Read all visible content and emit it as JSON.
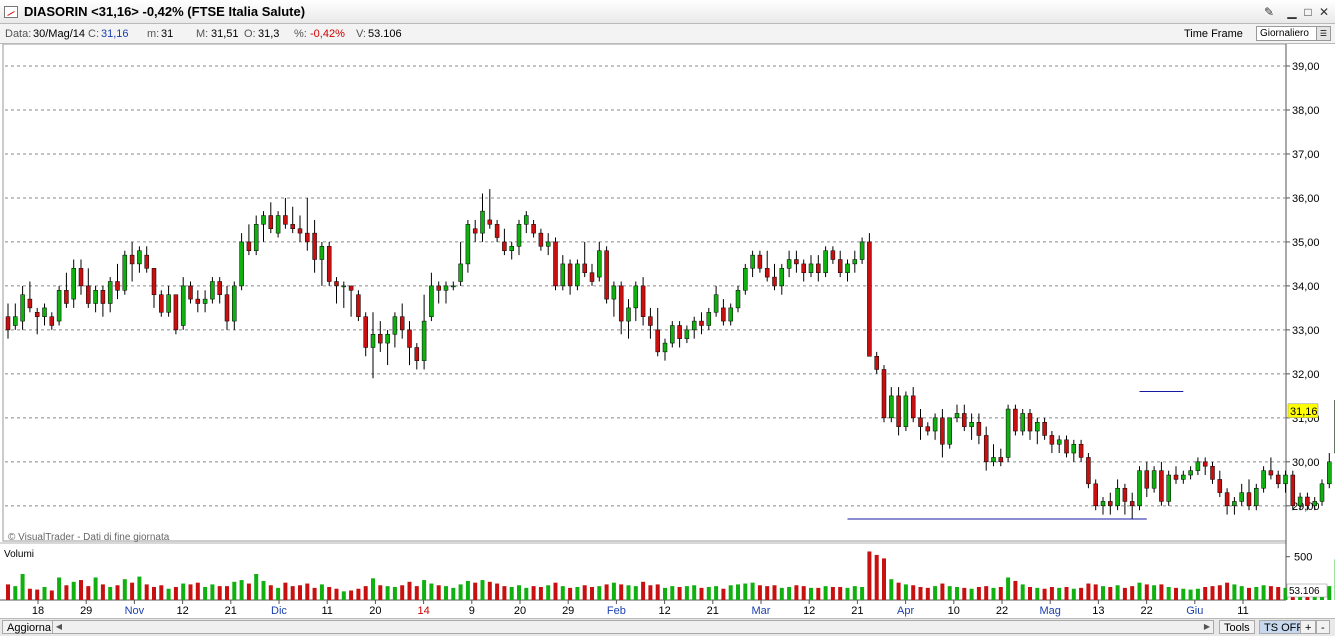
{
  "window": {
    "title": "DIASORIN <31,16> -0,42%  (FTSE Italia Salute)",
    "buttons": [
      "pin",
      "minimize",
      "maximize",
      "close"
    ]
  },
  "infobar": {
    "date_label": "Data:",
    "date_value": "30/Mag/14",
    "close_label": "C:",
    "close_value": "31,16",
    "min_label": "m:",
    "min_value": "31",
    "max_label": "M:",
    "max_value": "31,51",
    "open_label": "O:",
    "open_value": "31,3",
    "pct_label": "%:",
    "pct_value": "-0,42%",
    "vol_label": "V:",
    "vol_value": "53.106",
    "timeframe_label": "Time Frame",
    "timeframe_value": "Giornaliero"
  },
  "footer": {
    "refresh_button": "Aggiorna",
    "tools_button": "Tools",
    "ts_button": "TS OFF",
    "plus": "+",
    "minus": "-"
  },
  "colors": {
    "up": "#10b010",
    "down": "#c81010",
    "line": "#1818a0",
    "last_price_bg": "#ffff00"
  },
  "chart_data": {
    "type": "candlestick",
    "price_axis": {
      "ticks": [
        "29,00",
        "30,00",
        "31,00",
        "32,00",
        "33,00",
        "34,00",
        "35,00",
        "36,00",
        "37,00",
        "38,00",
        "39,00"
      ],
      "range": [
        28.2,
        39.5
      ],
      "grid": true
    },
    "last_price_label": "31,16",
    "watermark": "© VisualTrader - Dati di fine giornata",
    "volume_panel": {
      "label": "Volumi",
      "tick": "500",
      "last_value": "53.106",
      "max": 600
    },
    "x_ticks": [
      {
        "label": "18",
        "color": "#000"
      },
      {
        "label": "29",
        "color": "#000"
      },
      {
        "label": "Nov",
        "color": "#1a3fb0"
      },
      {
        "label": "12",
        "color": "#000"
      },
      {
        "label": "21",
        "color": "#000"
      },
      {
        "label": "Dic",
        "color": "#1a3fb0"
      },
      {
        "label": "11",
        "color": "#000"
      },
      {
        "label": "20",
        "color": "#000"
      },
      {
        "label": "14",
        "color": "#d00000"
      },
      {
        "label": "9",
        "color": "#000"
      },
      {
        "label": "20",
        "color": "#000"
      },
      {
        "label": "29",
        "color": "#000"
      },
      {
        "label": "Feb",
        "color": "#1a3fb0"
      },
      {
        "label": "12",
        "color": "#000"
      },
      {
        "label": "21",
        "color": "#000"
      },
      {
        "label": "Mar",
        "color": "#1a3fb0"
      },
      {
        "label": "12",
        "color": "#000"
      },
      {
        "label": "21",
        "color": "#000"
      },
      {
        "label": "Apr",
        "color": "#1a3fb0"
      },
      {
        "label": "10",
        "color": "#000"
      },
      {
        "label": "22",
        "color": "#000"
      },
      {
        "label": "Mag",
        "color": "#1a3fb0"
      },
      {
        "label": "13",
        "color": "#000"
      },
      {
        "label": "22",
        "color": "#000"
      },
      {
        "label": "Giu",
        "color": "#1a3fb0"
      },
      {
        "label": "11",
        "color": "#000"
      }
    ],
    "support_line": {
      "value": 28.7,
      "from_index": 115,
      "to_index": 156
    },
    "resistance_line": {
      "value": 31.6,
      "from_index": 155,
      "to_index": 161
    },
    "candles": [
      [
        33.3,
        33.6,
        32.8,
        33.0,
        180
      ],
      [
        33.1,
        33.6,
        33.0,
        33.3,
        160
      ],
      [
        33.2,
        34.0,
        33.0,
        33.8,
        300
      ],
      [
        33.7,
        34.1,
        33.4,
        33.5,
        130
      ],
      [
        33.4,
        33.5,
        32.9,
        33.3,
        120
      ],
      [
        33.3,
        33.6,
        33.1,
        33.5,
        150
      ],
      [
        33.3,
        33.4,
        33.0,
        33.1,
        110
      ],
      [
        33.2,
        34.0,
        33.1,
        33.9,
        260
      ],
      [
        33.9,
        34.3,
        33.5,
        33.6,
        170
      ],
      [
        33.7,
        34.6,
        33.5,
        34.4,
        210
      ],
      [
        34.4,
        34.6,
        33.8,
        34.0,
        230
      ],
      [
        34.0,
        34.4,
        33.5,
        33.6,
        160
      ],
      [
        33.6,
        34.0,
        33.4,
        33.9,
        260
      ],
      [
        33.9,
        34.0,
        33.3,
        33.6,
        180
      ],
      [
        33.6,
        34.2,
        33.4,
        34.1,
        150
      ],
      [
        34.1,
        34.5,
        33.7,
        33.9,
        170
      ],
      [
        33.9,
        34.8,
        33.8,
        34.7,
        240
      ],
      [
        34.7,
        35.0,
        34.1,
        34.5,
        200
      ],
      [
        34.5,
        34.9,
        34.3,
        34.8,
        270
      ],
      [
        34.7,
        34.9,
        34.3,
        34.4,
        180
      ],
      [
        34.4,
        34.4,
        33.5,
        33.8,
        150
      ],
      [
        33.8,
        33.9,
        33.3,
        33.4,
        170
      ],
      [
        33.4,
        34.0,
        33.3,
        33.8,
        130
      ],
      [
        33.8,
        33.8,
        32.9,
        33.0,
        150
      ],
      [
        33.1,
        34.2,
        33.0,
        34.0,
        190
      ],
      [
        34.0,
        34.1,
        33.6,
        33.7,
        180
      ],
      [
        33.7,
        33.9,
        33.4,
        33.6,
        200
      ],
      [
        33.6,
        33.9,
        33.4,
        33.7,
        150
      ],
      [
        33.7,
        34.2,
        33.6,
        34.1,
        180
      ],
      [
        34.1,
        34.2,
        33.6,
        33.8,
        160
      ],
      [
        33.8,
        34.0,
        33.0,
        33.2,
        160
      ],
      [
        33.2,
        34.1,
        33.0,
        34.0,
        210
      ],
      [
        34.0,
        35.2,
        33.9,
        35.0,
        230
      ],
      [
        35.0,
        35.4,
        34.7,
        34.8,
        190
      ],
      [
        34.8,
        35.6,
        34.7,
        35.4,
        300
      ],
      [
        35.4,
        35.7,
        35.0,
        35.6,
        220
      ],
      [
        35.6,
        35.9,
        35.2,
        35.3,
        170
      ],
      [
        35.2,
        35.7,
        35.1,
        35.6,
        140
      ],
      [
        35.6,
        36.0,
        35.3,
        35.4,
        200
      ],
      [
        35.4,
        35.8,
        35.2,
        35.3,
        160
      ],
      [
        35.3,
        35.6,
        35.0,
        35.2,
        170
      ],
      [
        35.2,
        36.0,
        34.8,
        35.0,
        190
      ],
      [
        35.2,
        35.5,
        34.3,
        34.6,
        140
      ],
      [
        34.6,
        35.0,
        34.0,
        34.9,
        180
      ],
      [
        34.9,
        35.0,
        34.0,
        34.1,
        150
      ],
      [
        34.1,
        34.2,
        33.6,
        34.0,
        130
      ],
      [
        34.0,
        34.1,
        33.5,
        34.0,
        100
      ],
      [
        34.0,
        34.0,
        33.3,
        33.9,
        110
      ],
      [
        33.8,
        33.9,
        33.2,
        33.3,
        130
      ],
      [
        33.3,
        33.4,
        32.4,
        32.6,
        160
      ],
      [
        32.6,
        33.4,
        31.9,
        32.9,
        250
      ],
      [
        32.9,
        33.2,
        32.5,
        32.7,
        170
      ],
      [
        32.7,
        33.0,
        32.2,
        32.9,
        160
      ],
      [
        32.9,
        33.4,
        32.6,
        33.3,
        150
      ],
      [
        33.3,
        33.6,
        32.8,
        33.0,
        170
      ],
      [
        33.0,
        33.2,
        32.2,
        32.6,
        210
      ],
      [
        32.6,
        32.7,
        32.1,
        32.3,
        160
      ],
      [
        32.3,
        33.8,
        32.1,
        33.2,
        230
      ],
      [
        33.3,
        34.3,
        33.2,
        34.0,
        190
      ],
      [
        34.0,
        34.1,
        33.6,
        33.9,
        170
      ],
      [
        33.9,
        34.1,
        33.6,
        34.0,
        160
      ],
      [
        34.0,
        34.1,
        33.9,
        34.0,
        140
      ],
      [
        34.1,
        35.0,
        34.0,
        34.5,
        180
      ],
      [
        34.5,
        35.5,
        34.3,
        35.4,
        220
      ],
      [
        35.3,
        35.5,
        35.0,
        35.2,
        200
      ],
      [
        35.2,
        36.1,
        35.0,
        35.7,
        230
      ],
      [
        35.5,
        36.2,
        35.3,
        35.4,
        210
      ],
      [
        35.4,
        35.5,
        35.0,
        35.1,
        190
      ],
      [
        35.0,
        35.3,
        34.7,
        34.8,
        160
      ],
      [
        34.8,
        35.0,
        34.6,
        34.9,
        150
      ],
      [
        34.9,
        35.5,
        34.7,
        35.4,
        170
      ],
      [
        35.4,
        35.7,
        35.2,
        35.6,
        140
      ],
      [
        35.4,
        35.5,
        35.1,
        35.2,
        160
      ],
      [
        35.2,
        35.3,
        34.8,
        34.9,
        150
      ],
      [
        34.9,
        35.2,
        34.7,
        35.0,
        170
      ],
      [
        35.0,
        35.1,
        33.9,
        34.0,
        200
      ],
      [
        34.0,
        34.7,
        33.9,
        34.5,
        160
      ],
      [
        34.5,
        34.6,
        33.8,
        34.0,
        140
      ],
      [
        34.0,
        34.6,
        33.9,
        34.5,
        150
      ],
      [
        34.5,
        35.0,
        34.2,
        34.3,
        170
      ],
      [
        34.3,
        34.5,
        34.0,
        34.1,
        150
      ],
      [
        34.2,
        35.0,
        34.1,
        34.8,
        160
      ],
      [
        34.8,
        34.9,
        33.6,
        33.7,
        180
      ],
      [
        33.7,
        34.1,
        33.3,
        34.0,
        200
      ],
      [
        34.0,
        34.1,
        32.9,
        33.2,
        180
      ],
      [
        33.2,
        33.7,
        32.8,
        33.5,
        170
      ],
      [
        33.5,
        34.1,
        33.2,
        34.0,
        160
      ],
      [
        34.0,
        34.2,
        33.1,
        33.3,
        210
      ],
      [
        33.3,
        33.5,
        32.8,
        33.1,
        170
      ],
      [
        33.0,
        33.5,
        32.4,
        32.5,
        180
      ],
      [
        32.5,
        32.8,
        32.3,
        32.7,
        140
      ],
      [
        32.7,
        33.2,
        32.6,
        33.1,
        160
      ],
      [
        33.1,
        33.2,
        32.6,
        32.8,
        150
      ],
      [
        32.8,
        33.1,
        32.7,
        33.0,
        160
      ],
      [
        33.0,
        33.3,
        32.8,
        33.2,
        170
      ],
      [
        33.2,
        33.4,
        32.9,
        33.1,
        140
      ],
      [
        33.1,
        33.5,
        33.0,
        33.4,
        150
      ],
      [
        33.4,
        34.0,
        33.3,
        33.8,
        160
      ],
      [
        33.5,
        33.7,
        33.1,
        33.2,
        130
      ],
      [
        33.2,
        33.6,
        33.1,
        33.5,
        170
      ],
      [
        33.5,
        34.0,
        33.4,
        33.9,
        180
      ],
      [
        33.9,
        34.5,
        33.8,
        34.4,
        190
      ],
      [
        34.4,
        34.8,
        34.2,
        34.7,
        200
      ],
      [
        34.7,
        34.8,
        34.3,
        34.4,
        170
      ],
      [
        34.4,
        34.8,
        34.1,
        34.2,
        160
      ],
      [
        34.2,
        34.5,
        33.9,
        34.0,
        170
      ],
      [
        34.0,
        34.5,
        33.8,
        34.4,
        140
      ],
      [
        34.4,
        34.8,
        34.2,
        34.6,
        150
      ],
      [
        34.6,
        34.8,
        34.3,
        34.5,
        170
      ],
      [
        34.5,
        34.6,
        34.1,
        34.3,
        160
      ],
      [
        34.3,
        34.7,
        34.2,
        34.5,
        140
      ],
      [
        34.5,
        34.7,
        34.1,
        34.3,
        140
      ],
      [
        34.3,
        34.9,
        34.2,
        34.8,
        160
      ],
      [
        34.8,
        34.9,
        34.5,
        34.6,
        150
      ],
      [
        34.6,
        34.8,
        34.2,
        34.3,
        150
      ],
      [
        34.3,
        34.6,
        34.1,
        34.5,
        140
      ],
      [
        34.5,
        34.8,
        34.3,
        34.6,
        160
      ],
      [
        34.6,
        35.1,
        34.5,
        35.0,
        150
      ],
      [
        35.0,
        35.2,
        32.5,
        32.4,
        560
      ],
      [
        32.4,
        32.5,
        32.0,
        32.1,
        520
      ],
      [
        32.1,
        32.2,
        30.9,
        31.0,
        480
      ],
      [
        31.0,
        31.7,
        30.9,
        31.5,
        240
      ],
      [
        31.5,
        31.7,
        30.6,
        30.8,
        200
      ],
      [
        30.8,
        31.6,
        30.7,
        31.5,
        180
      ],
      [
        31.5,
        31.7,
        30.9,
        31.0,
        170
      ],
      [
        31.0,
        31.2,
        30.5,
        30.8,
        150
      ],
      [
        30.8,
        30.9,
        30.6,
        30.7,
        140
      ],
      [
        30.7,
        31.1,
        30.5,
        31.0,
        160
      ],
      [
        31.0,
        31.2,
        30.1,
        30.4,
        190
      ],
      [
        30.4,
        31.0,
        30.3,
        31.0,
        160
      ],
      [
        31.0,
        31.3,
        30.9,
        31.1,
        150
      ],
      [
        31.1,
        31.3,
        30.7,
        30.8,
        140
      ],
      [
        30.8,
        31.1,
        30.5,
        30.9,
        130
      ],
      [
        30.9,
        31.1,
        30.4,
        30.6,
        150
      ],
      [
        30.6,
        30.8,
        29.8,
        30.0,
        160
      ],
      [
        30.0,
        30.4,
        29.9,
        30.1,
        140
      ],
      [
        30.1,
        30.3,
        29.9,
        30.0,
        150
      ],
      [
        30.1,
        31.3,
        30.0,
        31.2,
        260
      ],
      [
        31.2,
        31.3,
        30.6,
        30.7,
        220
      ],
      [
        30.7,
        31.2,
        30.6,
        31.1,
        180
      ],
      [
        31.1,
        31.2,
        30.5,
        30.7,
        150
      ],
      [
        30.7,
        31.0,
        30.4,
        30.9,
        140
      ],
      [
        30.9,
        31.0,
        30.5,
        30.6,
        130
      ],
      [
        30.6,
        30.7,
        30.2,
        30.4,
        150
      ],
      [
        30.4,
        30.6,
        30.2,
        30.5,
        140
      ],
      [
        30.5,
        30.6,
        30.1,
        30.2,
        150
      ],
      [
        30.2,
        30.5,
        30.0,
        30.4,
        130
      ],
      [
        30.4,
        30.5,
        30.0,
        30.1,
        140
      ],
      [
        30.1,
        30.2,
        29.4,
        29.5,
        190
      ],
      [
        29.5,
        29.6,
        28.9,
        29.0,
        180
      ],
      [
        29.0,
        29.2,
        28.8,
        29.1,
        160
      ],
      [
        29.1,
        29.3,
        28.8,
        29.0,
        150
      ],
      [
        29.0,
        29.6,
        28.9,
        29.4,
        170
      ],
      [
        29.4,
        29.5,
        28.8,
        29.1,
        140
      ],
      [
        29.1,
        29.3,
        28.7,
        29.0,
        160
      ],
      [
        29.0,
        29.9,
        28.9,
        29.8,
        200
      ],
      [
        29.8,
        30.0,
        29.2,
        29.4,
        180
      ],
      [
        29.4,
        29.9,
        29.3,
        29.8,
        170
      ],
      [
        29.8,
        30.0,
        29.0,
        29.1,
        180
      ],
      [
        29.1,
        29.8,
        29.0,
        29.7,
        150
      ],
      [
        29.7,
        29.9,
        29.5,
        29.6,
        140
      ],
      [
        29.6,
        29.8,
        29.5,
        29.7,
        130
      ],
      [
        29.7,
        29.9,
        29.6,
        29.8,
        120
      ],
      [
        29.8,
        30.1,
        29.7,
        30.0,
        130
      ],
      [
        30.0,
        30.1,
        29.7,
        29.9,
        150
      ],
      [
        29.9,
        30.0,
        29.5,
        29.6,
        160
      ],
      [
        29.6,
        29.8,
        29.2,
        29.3,
        170
      ],
      [
        29.3,
        29.4,
        28.8,
        29.0,
        200
      ],
      [
        29.0,
        29.2,
        28.8,
        29.1,
        180
      ],
      [
        29.1,
        29.5,
        29.0,
        29.3,
        160
      ],
      [
        29.3,
        29.6,
        28.9,
        29.0,
        140
      ],
      [
        29.0,
        29.5,
        28.9,
        29.4,
        150
      ],
      [
        29.4,
        29.9,
        29.3,
        29.8,
        170
      ],
      [
        29.8,
        30.1,
        29.6,
        29.7,
        160
      ],
      [
        29.7,
        29.8,
        29.4,
        29.5,
        150
      ],
      [
        29.5,
        29.8,
        29.3,
        29.7,
        140
      ],
      [
        29.7,
        29.8,
        28.9,
        29.0,
        130
      ],
      [
        29.0,
        29.3,
        28.9,
        29.2,
        120
      ],
      [
        29.2,
        29.3,
        28.9,
        29.0,
        110
      ],
      [
        29.0,
        29.2,
        28.9,
        29.1,
        100
      ],
      [
        29.1,
        29.6,
        29.0,
        29.5,
        140
      ],
      [
        29.5,
        30.2,
        29.4,
        30.0,
        160
      ],
      [
        30.2,
        31.6,
        30.1,
        31.4,
        470
      ],
      [
        31.4,
        31.5,
        31.1,
        31.3,
        250
      ],
      [
        31.3,
        31.51,
        31.0,
        31.16,
        106
      ]
    ]
  }
}
